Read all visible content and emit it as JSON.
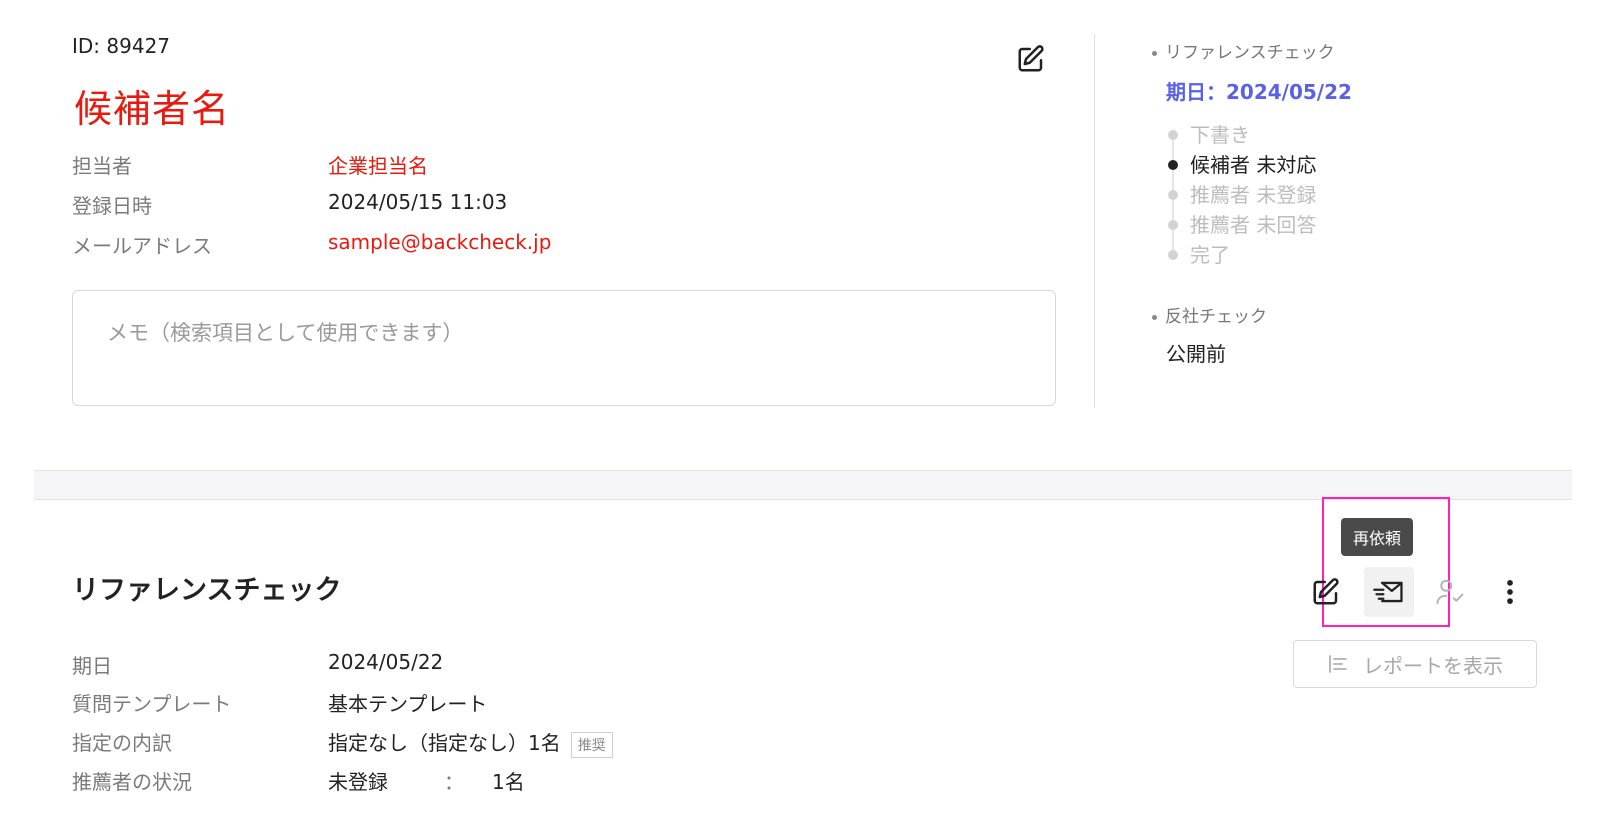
{
  "candidate": {
    "id": "ID: 89427",
    "name": "候補者名",
    "fields": [
      {
        "label": "担当者",
        "value": "企業担当名"
      },
      {
        "label": "登録日時",
        "value": "2024/05/15 11:03"
      },
      {
        "label": "メールアドレス",
        "value": "sample@backcheck.jp"
      }
    ],
    "memo_placeholder": "メモ（検索項目として使用できます）"
  },
  "sidebar": {
    "reference_check_heading": "リファレンスチェック",
    "due_label": "期日：",
    "due_date": "2024/05/22",
    "steps": [
      {
        "label": "下書き",
        "active": false
      },
      {
        "label": "候補者 未対応",
        "active": true
      },
      {
        "label": "推薦者 未登録",
        "active": false
      },
      {
        "label": "推薦者 未回答",
        "active": false
      },
      {
        "label": "完了",
        "active": false
      }
    ],
    "antisocial_heading": "反社チェック",
    "antisocial_status": "公開前"
  },
  "reference_section": {
    "title": "リファレンスチェック",
    "tooltip": "再依頼",
    "report_button": "レポートを表示",
    "details": [
      {
        "label": "期日",
        "value": "2024/05/22"
      },
      {
        "label": "質問テンプレート",
        "value": "基本テンプレート"
      },
      {
        "label": "指定の内訳",
        "value": "指定なし（指定なし）1名",
        "tag": "推奨"
      },
      {
        "label": "推薦者の状況",
        "value": "未登録",
        "sep": "：",
        "count": "1名"
      }
    ]
  },
  "colors": {
    "accent_red": "#e8190e",
    "due_blue": "#5b61e6",
    "highlight_pink": "#ff1fbf"
  }
}
